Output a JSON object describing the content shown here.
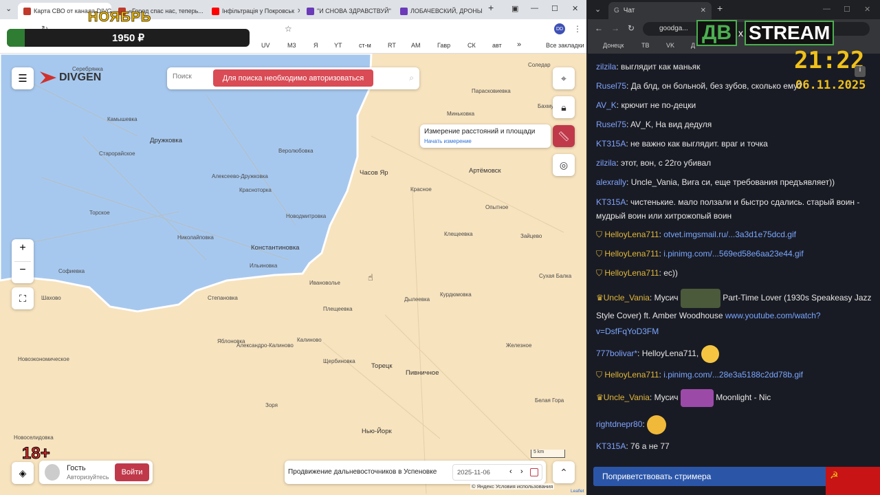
{
  "left_browser": {
    "tabs": [
      {
        "title": "Карта СВО от канала DIVGEN",
        "active": true,
        "color": "#c0392b"
      },
      {
        "title": "«Город спас нас, теперь...",
        "active": false,
        "color": "#c0392b"
      },
      {
        "title": "Інфільтрація у Покровськ",
        "active": false,
        "color": "#ff0000"
      },
      {
        "title": "\"И СНОВА ЗДРАВСТВУЙ\"",
        "active": false,
        "color": "#6a3ab8"
      },
      {
        "title": "ЛОБАЧЕВСКИЙ, ДРОНЫ",
        "active": false,
        "color": "#6a3ab8"
      }
    ],
    "bookmarks": [
      "UV",
      "M3",
      "Я",
      "YT",
      "ст-м",
      "RT",
      "AM",
      "Гавр",
      "СК",
      "авт",
      "Все закладки"
    ],
    "overlay": {
      "month": "НОЯБРЬ",
      "amount": "1950 ₽"
    }
  },
  "map": {
    "brand": "DIVGEN",
    "search_placeholder": "Поиск",
    "search_notice": "Для поиска необходимо авторизоваться",
    "measure_title": "Измерение расстояний и площади",
    "measure_link": "Начать измерение",
    "zoom_in": "+",
    "zoom_out": "−",
    "towns": [
      "Миньковка",
      "Серебрянка",
      "Камышевка",
      "Дружковка",
      "Старорайское",
      "Веролюбовка",
      "Алексеево-Дружковка",
      "Красноторка",
      "Торское",
      "Новодмитровка",
      "Николайповка",
      "Константиновка",
      "Ильиновка",
      "Софиевка",
      "Шахово",
      "Степановка",
      "Ивановолье",
      "Плещеевка",
      "Яблоновка",
      "Калиново",
      "Александро-Калиново",
      "Новоэкономическое",
      "Щербиновка",
      "Торецк",
      "Пивничное",
      "Нью-Йорк",
      "Новоселидовка",
      "Зоря",
      "Часов Яр",
      "Артёмовск",
      "Красное",
      "Опытное",
      "Клещеевка",
      "Зайцево",
      "Курдюмовка",
      "Сухая Балка",
      "Дылеевка",
      "Железное",
      "Соледар",
      "Бахмутское",
      "Парасковиевка",
      "Белая Гора"
    ],
    "guest_label": "Гость",
    "guest_sub": "Авторизуйтесь",
    "login_button": "Войти",
    "age_badge": "18+",
    "news_text": "Продвижение дальневосточников в Успеновке",
    "date": "2025-11-06",
    "scale": "5 km",
    "attribution": "© Яндекс Условия использования",
    "leaflet": "Leaflet"
  },
  "right_browser": {
    "tab_title": "Чат",
    "address": "goodga...",
    "bookmarks": [
      "Донецк",
      "ТВ",
      "VK",
      "Д"
    ],
    "logo_left": "ДВ",
    "logo_x": "x",
    "logo_right": "STREAM",
    "time": "21:22",
    "date": "06.11.2025",
    "welcome_button": "Поприветствовать стримера"
  },
  "chat": [
    {
      "user": "zilzila",
      "color": "#7fa3ff",
      "text": "выглядит как маньяк"
    },
    {
      "user": "Rusel75",
      "color": "#7fa3ff",
      "text": "Да блд, он больной, без зубов, сколько ему?"
    },
    {
      "user": "AV_K",
      "color": "#7fa3ff",
      "text": "крючит не по-децки"
    },
    {
      "user": "Rusel75",
      "color": "#7fa3ff",
      "text": "AV_K, На вид дедуля"
    },
    {
      "user": "KT315A",
      "color": "#7fa3ff",
      "text": "не важно как выглядит. враг и точка"
    },
    {
      "user": "zilzila",
      "color": "#7fa3ff",
      "text": "этот, вон, с 22го убивал"
    },
    {
      "user": "alexrally",
      "color": "#7fa3ff",
      "text": "Uncle_Vania, Вига си, еще требования предъявляет))"
    },
    {
      "user": "KT315A",
      "color": "#7fa3ff",
      "text": "чистенькие. мало ползали и быстро сдались. старый воин - мудрый воин или хитрожопый воин"
    },
    {
      "user": "HelloyLena711",
      "color": "#e0b73a",
      "text": "otvet.imgsmail.ru/...3a3d1e75dcd.gif",
      "link": true
    },
    {
      "user": "HelloyLena711",
      "color": "#e0b73a",
      "text": "i.pinimg.com/...569ed58e6aa23e44.gif",
      "link": true
    },
    {
      "user": "HelloyLena711",
      "color": "#e0b73a",
      "text": "ec))"
    },
    {
      "user": "Uncle_Vania",
      "color": "#e0b73a",
      "text": "Мусич",
      "after": "Part-Time Lover (1930s Speakeasy Jazz Style Cover) ft. Amber Woodhouse",
      "link_text": "www.youtube.com/watch?v=DsfFqYoD3FM"
    },
    {
      "user": "777bolivar*",
      "color": "#7fa3ff",
      "text": "HelloyLena711,"
    },
    {
      "user": "HelloyLena711",
      "color": "#e0b73a",
      "text": "i.pinimg.com/...28e3a5188c2dd78b.gif",
      "link": true
    },
    {
      "user": "Uncle_Vania",
      "color": "#e0b73a",
      "text": "Мусич",
      "after": "Moonlight - Nic"
    },
    {
      "user": "rightdnepr80",
      "color": "#7fa3ff",
      "text": ""
    },
    {
      "user": "KT315A",
      "color": "#7fa3ff",
      "text": "76 а не 77"
    }
  ]
}
